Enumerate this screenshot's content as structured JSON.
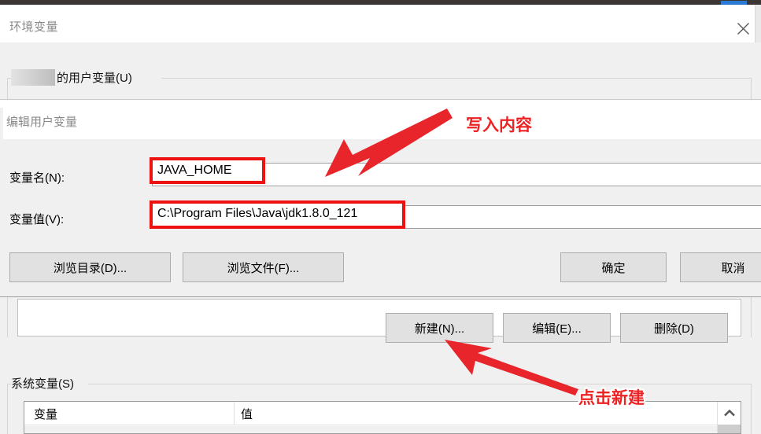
{
  "window": {
    "title": "环境变量",
    "close_icon": "close-icon"
  },
  "user_variables": {
    "group_label": "的用户变量(U)",
    "censored_username": "",
    "buttons": {
      "new": "新建(N)...",
      "edit": "编辑(E)...",
      "delete": "删除(D)"
    }
  },
  "system_variables": {
    "group_label": "系统变量(S)",
    "columns": [
      "变量",
      "值"
    ],
    "rows": []
  },
  "edit_dialog": {
    "title": "编辑用户变量",
    "fields": {
      "name_label": "变量名(N):",
      "name_value": "JAVA_HOME",
      "value_label": "变量值(V):",
      "value_value": "C:\\Program Files\\Java\\jdk1.8.0_121"
    },
    "buttons": {
      "browse_dir": "浏览目录(D)...",
      "browse_file": "浏览文件(F)...",
      "ok": "确定",
      "cancel": "取消"
    }
  },
  "annotations": {
    "write_content": "写入内容",
    "click_new": "点击新建",
    "color": "#ee2222"
  },
  "colors": {
    "highlight_red": "#ee1111",
    "dialog_bg": "#f0f0f0",
    "button_bg": "#e1e1e1",
    "title_text": "#8a8a8a"
  }
}
